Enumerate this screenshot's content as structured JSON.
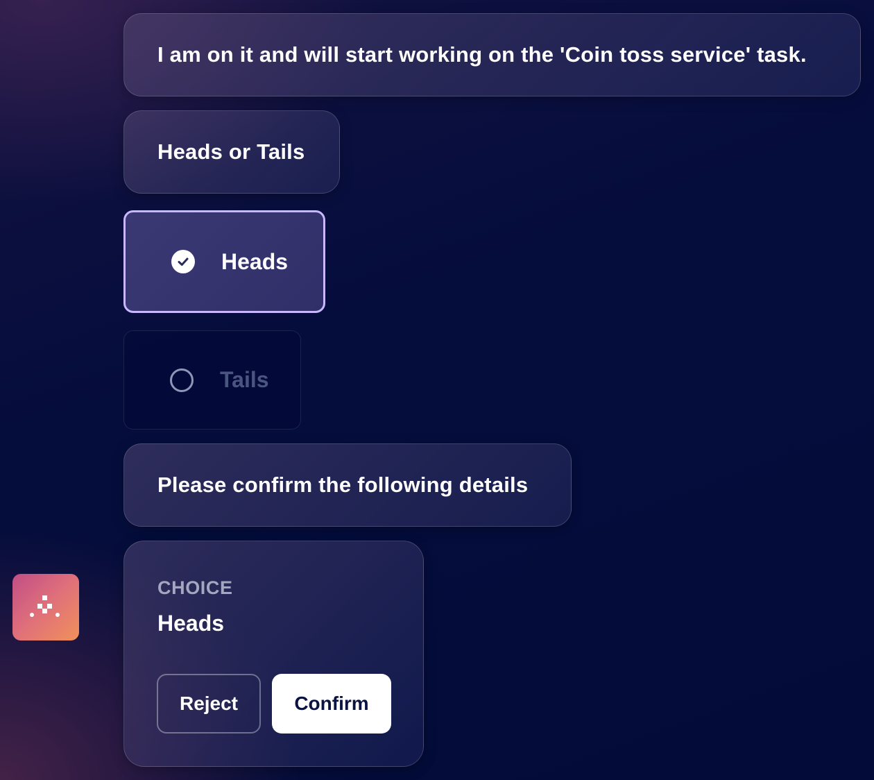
{
  "messages": {
    "status": "I am on it and will start working on the 'Coin toss service' task.",
    "question": "Heads or Tails",
    "confirm_prompt": "Please confirm the following details"
  },
  "options": {
    "selected": "Heads",
    "heads": "Heads",
    "tails": "Tails"
  },
  "confirmation": {
    "field_label": "CHOICE",
    "field_value": "Heads",
    "reject_label": "Reject",
    "confirm_label": "Confirm"
  },
  "icons": {
    "option_selected": "check-circle-icon",
    "option_unselected": "radio-empty-icon",
    "assistant_avatar": "app-logo-icon"
  },
  "colors": {
    "selected_border": "#c9b8ff",
    "avatar_gradient_start": "#c14e86",
    "avatar_gradient_end": "#f0915a",
    "confirm_button_bg": "#ffffff",
    "confirm_button_text": "#0b1340"
  }
}
